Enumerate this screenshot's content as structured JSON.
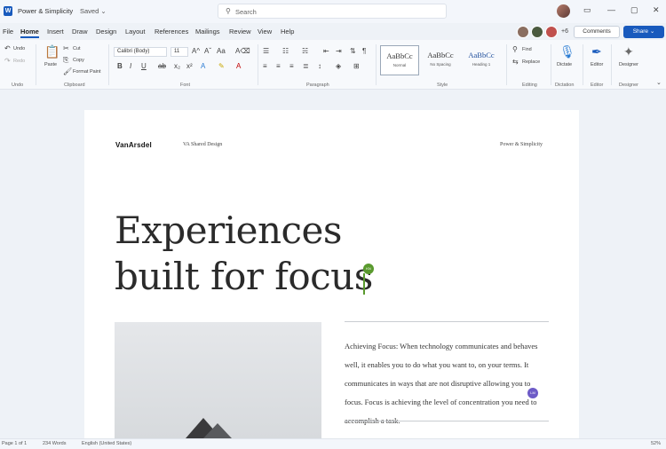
{
  "titlebar": {
    "app_icon": "word-logo-icon",
    "doc_title": "Power & Simplicity",
    "saved_status": "Saved ⌄",
    "search_placeholder": "Search",
    "win_controls": [
      "▭",
      "—",
      "▢",
      "✕"
    ]
  },
  "menu": {
    "tabs": [
      "File",
      "Home",
      "Insert",
      "Draw",
      "Design",
      "Layout",
      "References",
      "Mailings",
      "Review",
      "View",
      "Help"
    ],
    "active_tab": "Home",
    "extra_collaborators": "+6",
    "comments_label": "Comments",
    "share_label": "Share ⌄"
  },
  "ribbon": {
    "undo": "Undo",
    "redo": "Redo",
    "paste": "Paste",
    "cut": "Cut",
    "copy": "Copy",
    "format_painter": "Format Paint",
    "font_name": "Calibri (Body)",
    "font_size": "11",
    "styles": [
      {
        "sample": "AaBbCc",
        "name": "Normal"
      },
      {
        "sample": "AaBbCc",
        "name": "No Spacing"
      },
      {
        "sample": "AaBbCc",
        "name": "Heading 1"
      }
    ],
    "find": "Find",
    "replace": "Replace",
    "dictate": "Dictate",
    "editor": "Editor",
    "designer": "Designer",
    "groups": [
      "Undo",
      "Clipboard",
      "Font",
      "Paragraph",
      "Style",
      "Editing",
      "Dictation",
      "Editor",
      "Designer"
    ]
  },
  "document": {
    "brand": "VanArsdel",
    "header_mid": "VA Shared Design",
    "header_right": "Power & Simplicity",
    "headline_line1": "Experiences",
    "headline_line2": "built for focus",
    "body": "Achieving Focus: When technology communicates and behaves well, it enables you to do what you want to, on your terms. It communicates in ways that are not disruptive allowing you to focus. Focus is achieving the level of concentration you need to accomplish a task.",
    "cursor_tag_green": "KN",
    "cursor_tag_purple": "LM"
  },
  "status": {
    "page": "Page 1 of 1",
    "words": "234 Words",
    "language": "English (United States)",
    "zoom": "52%"
  },
  "colors": {
    "accent": "#185abd",
    "cursor_green": "#5a9a2e",
    "cursor_purple": "#6d5bc7"
  }
}
